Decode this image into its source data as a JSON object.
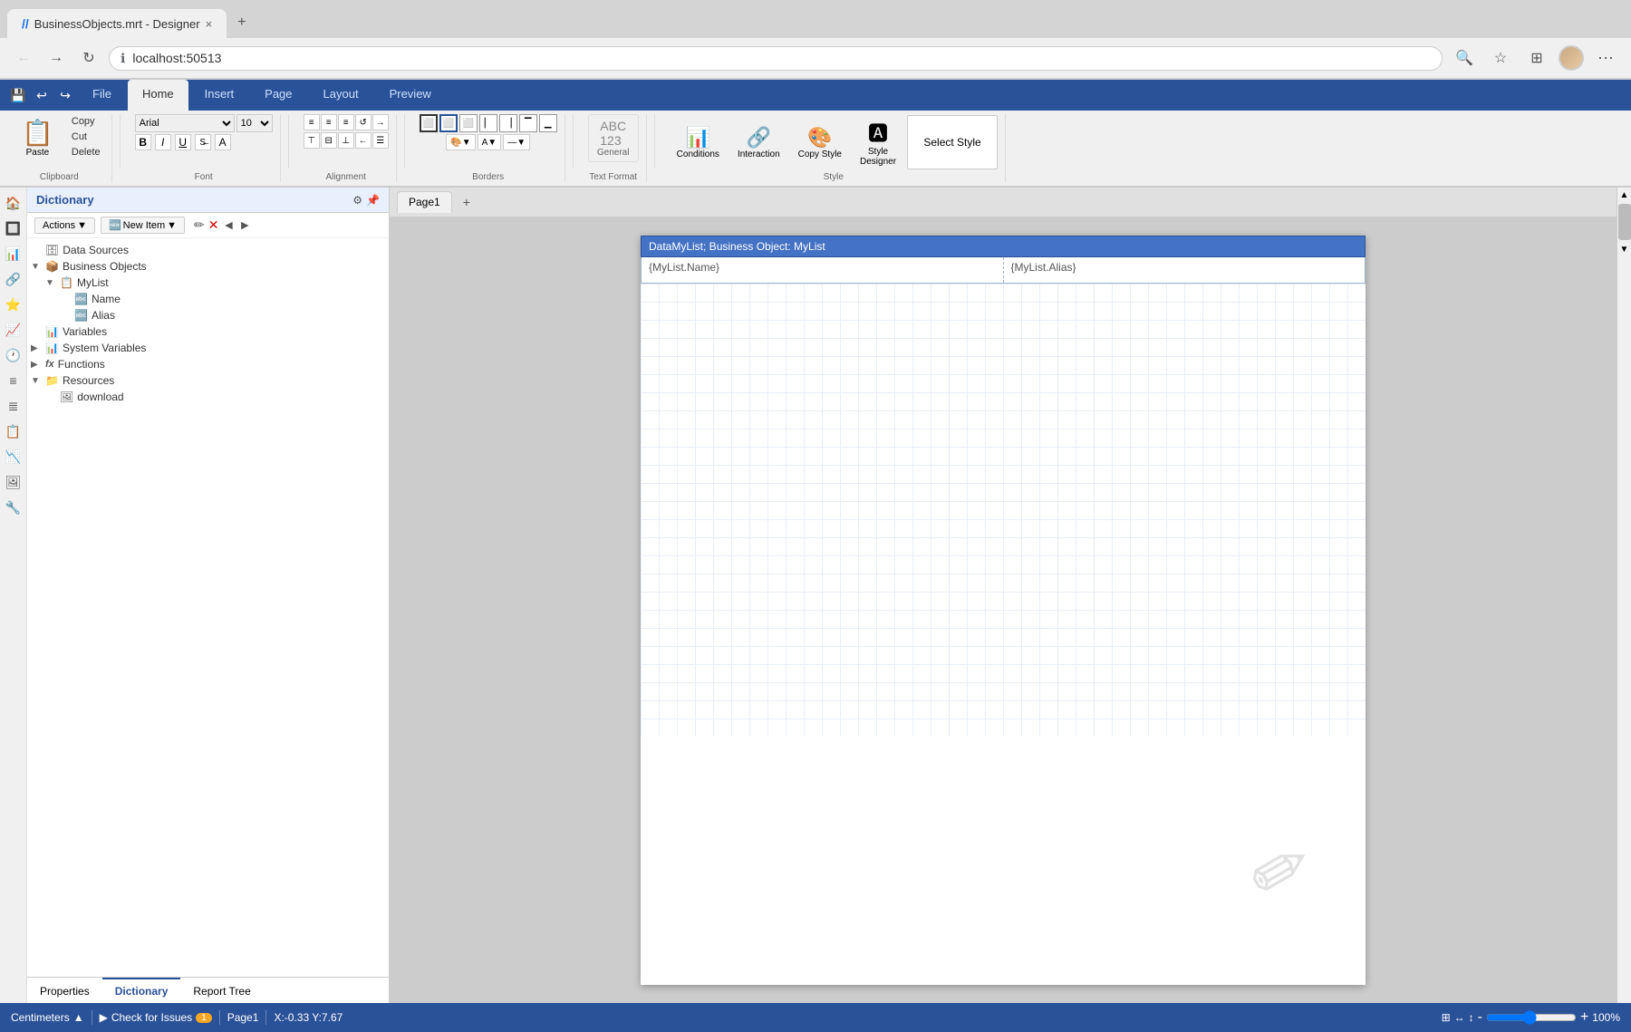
{
  "browser": {
    "tab_title": "BusinessObjects.mrt - Designer",
    "tab_icon": "//",
    "address": "localhost:50513",
    "close_label": "×",
    "new_tab_label": "+"
  },
  "ribbon": {
    "save_icon": "💾",
    "undo_icon": "↩",
    "redo_icon": "↪",
    "tabs": [
      "File",
      "Home",
      "Insert",
      "Page",
      "Layout",
      "Preview"
    ],
    "active_tab": "Home"
  },
  "toolbar": {
    "clipboard": {
      "paste_label": "Paste",
      "copy_label": "Copy",
      "cut_label": "Cut",
      "delete_label": "Delete"
    },
    "font": {
      "family_placeholder": "Arial",
      "size_placeholder": "10"
    },
    "alignment": {
      "label": "Alignment"
    },
    "borders": {
      "label": "Borders"
    },
    "text_format": {
      "label": "Text Format",
      "general_label": "General"
    },
    "style": {
      "label": "Style",
      "conditions_label": "Conditions",
      "interaction_label": "Interaction",
      "copy_style_label": "Copy Style",
      "style_designer_label": "Style Designer",
      "select_style_label": "Select Style"
    }
  },
  "dictionary": {
    "title": "Dictionary",
    "gear_icon": "⚙",
    "pin_icon": "📌",
    "actions_label": "Actions",
    "new_item_label": "New Item",
    "tree": [
      {
        "id": "data-sources",
        "label": "Data Sources",
        "icon": "🗄",
        "indent": 0,
        "expandable": false
      },
      {
        "id": "business-objects",
        "label": "Business Objects",
        "icon": "📦",
        "indent": 0,
        "expandable": true,
        "expanded": true
      },
      {
        "id": "mylist",
        "label": "MyList",
        "icon": "📋",
        "indent": 1,
        "expandable": true,
        "expanded": true
      },
      {
        "id": "name",
        "label": "Name",
        "icon": "🔤",
        "indent": 2,
        "expandable": false
      },
      {
        "id": "alias",
        "label": "Alias",
        "icon": "🔤",
        "indent": 2,
        "expandable": false
      },
      {
        "id": "variables",
        "label": "Variables",
        "icon": "📊",
        "indent": 0,
        "expandable": false
      },
      {
        "id": "system-variables",
        "label": "System Variables",
        "icon": "📊",
        "indent": 0,
        "expandable": true,
        "expanded": false
      },
      {
        "id": "functions",
        "label": "Functions",
        "icon": "fx",
        "indent": 0,
        "expandable": true,
        "expanded": false
      },
      {
        "id": "resources",
        "label": "Resources",
        "icon": "📁",
        "indent": 0,
        "expandable": true,
        "expanded": true
      },
      {
        "id": "download",
        "label": "download",
        "icon": "🖼",
        "indent": 1,
        "expandable": false
      }
    ],
    "tabs": [
      "Properties",
      "Dictionary",
      "Report Tree"
    ],
    "active_tab": "Dictionary"
  },
  "canvas": {
    "page1_label": "Page1",
    "plus_label": "+",
    "report_header": "DataMyList; Business Object: MyList",
    "cell1": "{MyList.Name}",
    "cell2": "{MyList.Alias}"
  },
  "status_bar": {
    "unit_label": "Centimeters",
    "check_issues_label": "Check for Issues",
    "warning_count": "1",
    "page_label": "Page1",
    "coords_label": "X:-0.33 Y:7.67",
    "zoom_minus": "-",
    "zoom_plus": "+",
    "zoom_level": "100%",
    "fit_page_icon": "⊞",
    "fit_width_icon": "↔",
    "fit_height_icon": "↕"
  },
  "side_icons": [
    "🏠",
    "🔲",
    "📊",
    "🔗",
    "⭐",
    "📈",
    "🕐",
    "≡",
    "≣",
    "📋",
    "📉",
    "🖼",
    "🔧"
  ],
  "icons": {
    "back": "←",
    "forward": "→",
    "refresh": "↻",
    "info": "ℹ",
    "search": "🔍",
    "star": "☆",
    "collection": "⊞",
    "profile": "👤",
    "more": "⋯",
    "expand": "▼",
    "collapse": "▲",
    "right_arrow": "▶",
    "settings": "⚙",
    "new_item_arrow": "▼",
    "edit": "✏",
    "delete": "✕",
    "arrow_left": "◄",
    "arrow_right": "►",
    "scroll_up": "▲",
    "scroll_down": "▼"
  }
}
